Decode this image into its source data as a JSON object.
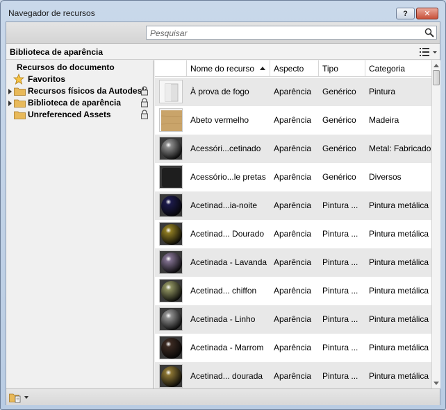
{
  "window": {
    "title": "Navegador de recursos",
    "help_label": "?",
    "close_label": "✕"
  },
  "search": {
    "placeholder": "Pesquisar"
  },
  "library_bar": {
    "title": "Biblioteca de aparência"
  },
  "tree": {
    "items": [
      {
        "label": "Recursos do documento",
        "icon": "none"
      },
      {
        "label": "Favoritos",
        "icon": "star-icon"
      },
      {
        "label": "Recursos físicos da Autodesk",
        "icon": "folder-icon",
        "expandable": true,
        "locked": true
      },
      {
        "label": "Biblioteca de aparência",
        "icon": "folder-icon",
        "expandable": true,
        "locked": true
      },
      {
        "label": "Unreferenced Assets",
        "icon": "folder-icon",
        "expandable": false,
        "locked": true
      }
    ]
  },
  "table": {
    "columns": [
      "Nome do recurso",
      "Aspecto",
      "Tipo",
      "Categoria"
    ],
    "sorted_column": "Nome do recurso",
    "rows": [
      {
        "name": "À prova de fogo",
        "aspect": "Aparência",
        "type": "Genérico",
        "category": "Pintura",
        "thumb": "white-cube",
        "color": "#e9e9e9"
      },
      {
        "name": "Abeto vermelho",
        "aspect": "Aparência",
        "type": "Genérico",
        "category": "Madeira",
        "thumb": "wood-cube",
        "color": "#c9a46a"
      },
      {
        "name": "Acessóri...cetinado",
        "aspect": "Aparência",
        "type": "Genérico",
        "category": "Metal: Fabricado",
        "thumb": "metal-sphere",
        "color": "#8a8a8a"
      },
      {
        "name": "Acessório...le pretas",
        "aspect": "Aparência",
        "type": "Genérico",
        "category": "Diversos",
        "thumb": "black-cube",
        "color": "#1e1e1e"
      },
      {
        "name": "Acetinad...ia-noite",
        "aspect": "Aparência",
        "type": "Pintura ...",
        "category": "Pintura metálica",
        "thumb": "sphere",
        "color": "#1c1a4a"
      },
      {
        "name": "Acetinad... Dourado",
        "aspect": "Aparência",
        "type": "Pintura ...",
        "category": "Pintura metálica",
        "thumb": "sphere",
        "color": "#8c7a22"
      },
      {
        "name": "Acetinada - Lavanda",
        "aspect": "Aparência",
        "type": "Pintura ...",
        "category": "Pintura metálica",
        "thumb": "sphere",
        "color": "#7e6e8c"
      },
      {
        "name": "Acetinad... chiffon",
        "aspect": "Aparência",
        "type": "Pintura ...",
        "category": "Pintura metálica",
        "thumb": "sphere",
        "color": "#8b8e5e"
      },
      {
        "name": "Acetinada - Linho",
        "aspect": "Aparência",
        "type": "Pintura ...",
        "category": "Pintura metálica",
        "thumb": "sphere",
        "color": "#8e8e8e"
      },
      {
        "name": "Acetinada - Marrom",
        "aspect": "Aparência",
        "type": "Pintura ...",
        "category": "Pintura metálica",
        "thumb": "sphere",
        "color": "#3b2a22"
      },
      {
        "name": "Acetinad... dourada",
        "aspect": "Aparência",
        "type": "Pintura ...",
        "category": "Pintura metálica",
        "thumb": "sphere",
        "color": "#8a7433"
      }
    ]
  }
}
